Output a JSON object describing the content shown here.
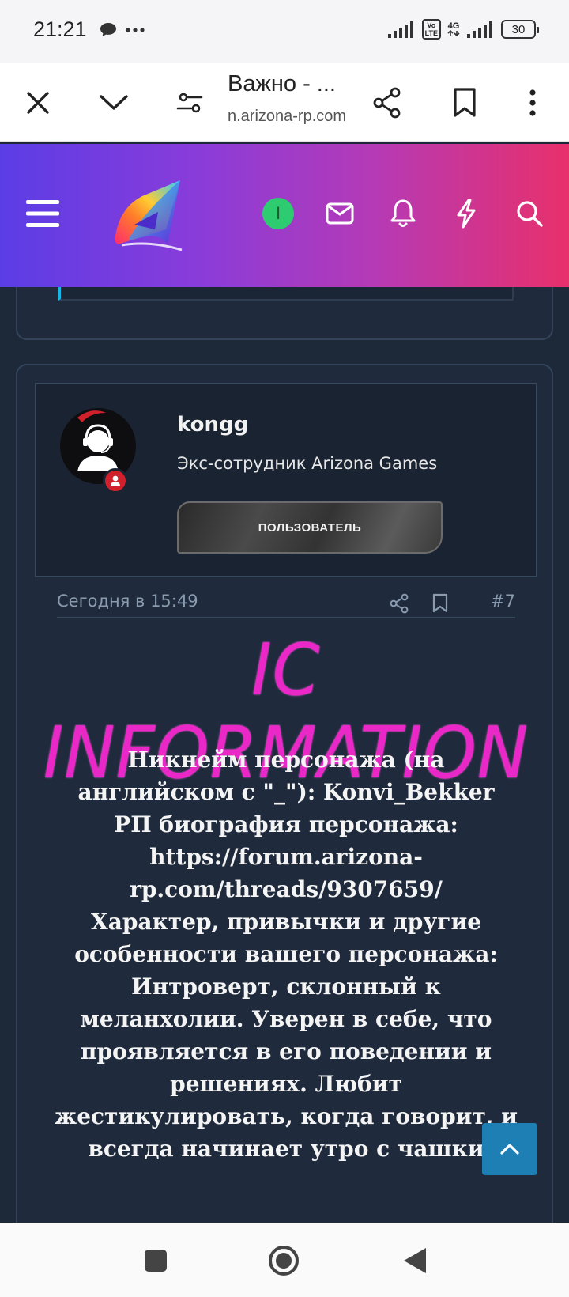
{
  "status_bar": {
    "time": "21:21",
    "battery": "30",
    "network": "4G",
    "volte": "Vo LTE"
  },
  "browser": {
    "page_title": "Важно - ...",
    "url": "n.arizona-rp.com",
    "icons": [
      "close-icon",
      "chevron-down-icon",
      "tune-icon",
      "share-icon",
      "bookmark-icon",
      "more-icon"
    ]
  },
  "site_header": {
    "online_letter": "I",
    "icons": [
      "menu-icon",
      "logo",
      "online-status",
      "mail-icon",
      "bell-icon",
      "lightning-icon",
      "search-icon"
    ],
    "colors": {
      "gradient_start": "#5b3de6",
      "gradient_end": "#e8306b"
    }
  },
  "post": {
    "username": "kongg",
    "user_title": "Экс-сотрудник Arizona Games",
    "user_banner": "ПОЛЬЗОВАТЕЛЬ",
    "date": "Сегодня в 15:49",
    "number": "#7",
    "header_image_text": "IC INFORMATION",
    "body_lines": [
      "Никнейм персонажа (на",
      "английском с \"_\"): Konvi_Bekker",
      "РП биография персонажа:",
      "https://forum.arizona-",
      "rp.com/threads/9307659/",
      "Характер, привычки и другие",
      "особенности вашего персонажа:",
      "Интроверт, склонный к",
      "меланхолии. Уверен в себе, что",
      "проявляется в его поведении и",
      "решениях. Любит",
      "жестикулировать, когда говорит, и",
      "всегда начинает утро с чашки"
    ]
  },
  "colors": {
    "page_bg": "#1d2939",
    "card_bg": "#1f2b3d",
    "ic_title": "#ea28c8",
    "scroll_top_bg": "#1e7fb5"
  }
}
